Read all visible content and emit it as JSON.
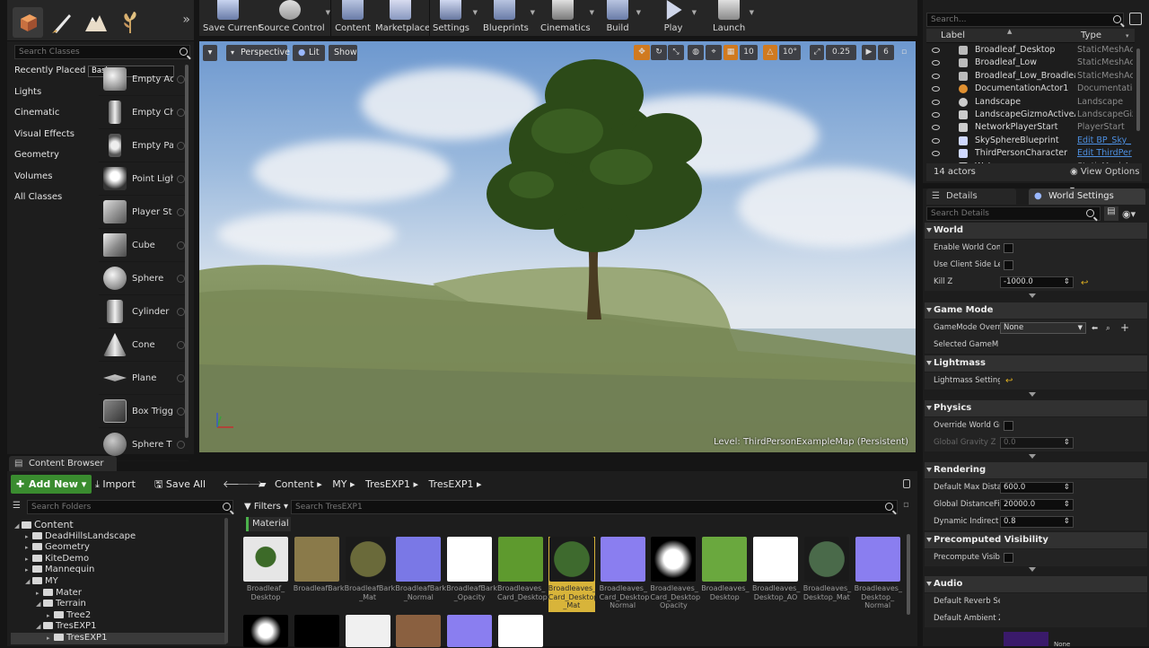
{
  "modes": {
    "search_placeholder": "Search Classes",
    "categories": [
      "Recently Placed",
      "Basic",
      "Lights",
      "Cinematic",
      "Visual Effects",
      "Geometry",
      "Volumes",
      "All Classes"
    ],
    "selected_category": "Basic",
    "items": [
      "Empty Ac",
      "Empty Ch",
      "Empty Pa",
      "Point Ligh",
      "Player St",
      "Cube",
      "Sphere",
      "Cylinder",
      "Cone",
      "Plane",
      "Box Trigg",
      "Sphere T"
    ]
  },
  "toolbar": {
    "buttons": [
      "Save Current",
      "Source Control",
      "Content",
      "Marketplace",
      "Settings",
      "Blueprints",
      "Cinematics",
      "Build",
      "Play",
      "Launch"
    ]
  },
  "viewport": {
    "mode_label": "Perspective",
    "lit_label": "Lit",
    "show_label": "Show",
    "grid_snap": "10",
    "rot_snap": "10°",
    "scale_snap": "0.25",
    "cam_speed": "6",
    "level_prefix": "Level:",
    "level_name": "ThirdPersonExampleMap (Persistent)"
  },
  "outliner": {
    "search_placeholder": "Search...",
    "col_label": "Label",
    "col_type": "Type",
    "rows": [
      {
        "name": "Broadleaf_Desktop",
        "type": "StaticMeshAct",
        "link": false
      },
      {
        "name": "Broadleaf_Low",
        "type": "StaticMeshAct",
        "link": false
      },
      {
        "name": "Broadleaf_Low_Broadleaf_",
        "type": "StaticMeshAct",
        "link": false
      },
      {
        "name": "DocumentationActor1",
        "type": "Documentation",
        "link": false
      },
      {
        "name": "Landscape",
        "type": "Landscape",
        "link": false
      },
      {
        "name": "LandscapeGizmoActiveActi",
        "type": "LandscapeGiz",
        "link": false
      },
      {
        "name": "NetworkPlayerStart",
        "type": "PlayerStart",
        "link": false
      },
      {
        "name": "SkySphereBlueprint",
        "type": "Edit BP_Sky_",
        "link": true
      },
      {
        "name": "ThirdPersonCharacter",
        "type": "Edit ThirdPer",
        "link": true
      },
      {
        "name": "Water",
        "type": "StaticMeshAct",
        "link": false
      }
    ],
    "actor_count": "14 actors",
    "view_options": "View Options"
  },
  "details": {
    "tab_details": "Details",
    "tab_world": "World Settings",
    "search_placeholder": "Search Details",
    "sections": {
      "world": "World",
      "game_mode": "Game Mode",
      "lightmass": "Lightmass",
      "physics": "Physics",
      "rendering": "Rendering",
      "precomputed": "Precomputed Visibility",
      "audio": "Audio"
    },
    "props": {
      "enable_world_comp": "Enable World Com",
      "use_client_side": "Use Client Side Le",
      "kill_z": "Kill Z",
      "kill_z_value": "-1000.0",
      "gamemode_override": "GameMode Overr",
      "gamemode_value": "None",
      "selected_gamemode": "Selected GameM",
      "lightmass_settings": "Lightmass Setting",
      "override_world_gravity": "Override World Gr",
      "global_gravity_z": "Global Gravity Z",
      "global_gravity_value": "0.0",
      "default_max_dist": "Default Max Dista",
      "default_max_dist_value": "600.0",
      "global_dist_field": "Global DistanceFie",
      "global_dist_field_value": "20000.0",
      "dynamic_indirect": "Dynamic Indirect",
      "dynamic_indirect_value": "0.8",
      "precomputed_vis": "Precompute Visib",
      "default_reverb": "Default Reverb Se",
      "default_ambient": "Default Ambient Z",
      "none_label": "None"
    }
  },
  "content_browser": {
    "tab_label": "Content Browser",
    "add_new": "Add New",
    "import": "Import",
    "save_all": "Save All",
    "breadcrumb": [
      "Content",
      "MY",
      "TresEXP1",
      "TresEXP1"
    ],
    "search_folders_placeholder": "Search Folders",
    "filters_label": "Filters",
    "search_assets_placeholder": "Search TresEXP1",
    "filter_chip": "Material",
    "tree": [
      {
        "label": "Content",
        "depth": 0,
        "open": true
      },
      {
        "label": "DeadHillsLandscape",
        "depth": 1,
        "open": false
      },
      {
        "label": "Geometry",
        "depth": 1,
        "open": false
      },
      {
        "label": "KiteDemo",
        "depth": 1,
        "open": false
      },
      {
        "label": "Mannequin",
        "depth": 1,
        "open": false
      },
      {
        "label": "MY",
        "depth": 1,
        "open": true
      },
      {
        "label": "Mater",
        "depth": 2,
        "open": false
      },
      {
        "label": "Terrain",
        "depth": 2,
        "open": true
      },
      {
        "label": "Tree2",
        "depth": 3,
        "open": false
      },
      {
        "label": "TresEXP1",
        "depth": 2,
        "open": true
      },
      {
        "label": "TresEXP1",
        "depth": 3,
        "open": false
      }
    ],
    "assets": [
      {
        "label": "Broadleaf_ Desktop",
        "color": "#5c8a3a"
      },
      {
        "label": "BroadleafBark",
        "color": "#8a7a4a"
      },
      {
        "label": "BroadleafBark _Mat",
        "color": "#6a6a3a"
      },
      {
        "label": "BroadleafBark _Normal",
        "color": "#7a78e6"
      },
      {
        "label": "BroadleafBark _Opacity",
        "color": "#ffffff"
      },
      {
        "label": "Broadleaves_ Card_Desktop",
        "color": "#5e9a2e"
      },
      {
        "label": "Broadleaves_ Card_Desktop _Mat",
        "color": "#3e6a2e"
      },
      {
        "label": "Broadleaves_ Card_Desktop Normal",
        "color": "#8a7ef0"
      },
      {
        "label": "Broadleaves_ Card_Desktop Opacity",
        "color": "#000000"
      },
      {
        "label": "Broadleaves_ Desktop",
        "color": "#6aa83e"
      },
      {
        "label": "Broadleaves_ Desktop_AO",
        "color": "#ffffff"
      },
      {
        "label": "Broadleaves_ Desktop_Mat",
        "color": "#4a6a4a"
      },
      {
        "label": "Broadleaves_ Desktop_ Normal",
        "color": "#8a7ef0"
      }
    ],
    "row2_colors": [
      "#000000",
      "#000000",
      "#f0f0f0",
      "#8a6040",
      "#8a7ef0",
      "#ffffff"
    ]
  }
}
